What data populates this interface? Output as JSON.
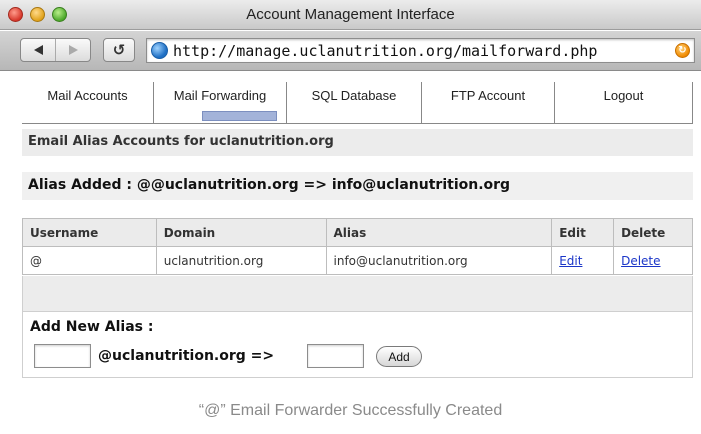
{
  "window": {
    "title": "Account Management Interface"
  },
  "toolbar": {
    "url": "http://manage.uclanutrition.org/mailforward.php",
    "reload_glyph": "↺",
    "icons": {
      "back": "back-arrow-icon",
      "forward": "forward-arrow-icon",
      "reload": "reload-icon",
      "site": "globe-icon",
      "feed": "rss-icon"
    }
  },
  "nav": {
    "tabs": [
      {
        "label": "Mail Accounts"
      },
      {
        "label": "Mail Forwarding"
      },
      {
        "label": "SQL Database"
      },
      {
        "label": "FTP Account"
      },
      {
        "label": "Logout"
      }
    ]
  },
  "section": {
    "title": "Email Alias Accounts for uclanutrition.org"
  },
  "alert": {
    "message": "Alias Added : @@uclanutrition.org => info@uclanutrition.org"
  },
  "table": {
    "headers": {
      "username": "Username",
      "domain": "Domain",
      "alias": "Alias",
      "edit": "Edit",
      "delete": "Delete"
    },
    "rows": [
      {
        "username": "@",
        "domain": "uclanutrition.org",
        "alias": "info@uclanutrition.org",
        "edit": "Edit",
        "delete": "Delete"
      }
    ]
  },
  "add_form": {
    "heading": "Add New Alias :",
    "alias_value": "",
    "domain_label": "@uclanutrition.org =>",
    "target_value": "",
    "button_label": "Add"
  },
  "caption": "“@” Email Forwarder Successfully Created",
  "colors": {
    "link": "#1a35c8",
    "active_tab_indicator": "#a3b3d9",
    "header_bg": "#ebebeb"
  }
}
